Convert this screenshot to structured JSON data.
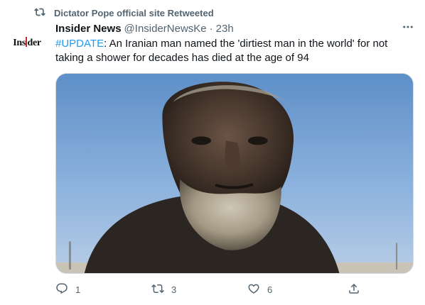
{
  "retweet_banner": {
    "icon": "retweet-icon",
    "text": "Dictator Pope official site Retweeted"
  },
  "tweet": {
    "avatar_logo_text": "Insider",
    "author_name": "Insider News",
    "author_handle": "@InsiderNewsKe",
    "separator": "·",
    "time": "23h",
    "hashtag": "#UPDATE",
    "body": ": An Iranian man named the 'dirtiest man in the world' for not taking a shower for decades has died at the age of 94",
    "more_icon": "more-icon",
    "media": {
      "kind": "photo",
      "subject": "elderly man with soot-covered face and grey beard against blue sky"
    }
  },
  "actions": {
    "reply": {
      "icon": "reply-icon",
      "count": "1"
    },
    "retweet": {
      "icon": "retweet-icon",
      "count": "3"
    },
    "like": {
      "icon": "like-icon",
      "count": "6"
    },
    "share": {
      "icon": "share-icon"
    }
  },
  "colors": {
    "text_primary": "#0f1419",
    "text_secondary": "#536471",
    "link": "#1d9bf0",
    "border": "#cfd9de"
  }
}
